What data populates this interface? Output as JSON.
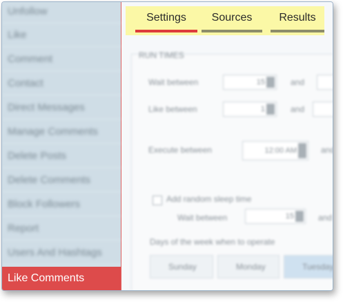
{
  "sidebar": {
    "items": [
      {
        "label": "Unfollow"
      },
      {
        "label": "Like"
      },
      {
        "label": "Comment"
      },
      {
        "label": "Contact"
      },
      {
        "label": "Direct Messages"
      },
      {
        "label": "Manage Comments"
      },
      {
        "label": "Delete Posts"
      },
      {
        "label": "Delete Comments"
      },
      {
        "label": "Block Followers"
      },
      {
        "label": "Report"
      },
      {
        "label": "Users And Hashtags"
      },
      {
        "label": "Like Comments"
      }
    ],
    "active_index": 11
  },
  "tabs": [
    {
      "label": "Settings",
      "active": true
    },
    {
      "label": "Sources",
      "active": false
    },
    {
      "label": "Results",
      "active": false
    }
  ],
  "settings": {
    "section_title": "RUN TIMES",
    "wait_between": {
      "label": "Wait between",
      "from": "15",
      "and_label": "and"
    },
    "like_between": {
      "label": "Like between",
      "from": "1",
      "and_label": "and"
    },
    "execute_between": {
      "label": "Execute between",
      "from": "12:00 AM",
      "and_label": "and"
    },
    "random_sleep": {
      "label": "Add random sleep time",
      "checked": true
    },
    "sleep_wait_between": {
      "label": "Wait between",
      "from": "15",
      "and_label": "and"
    },
    "days_label": "Days of the week when to operate",
    "days": [
      {
        "label": "Sunday",
        "checked": true
      },
      {
        "label": "Monday",
        "checked": true
      },
      {
        "label": "Tuesday",
        "checked": true
      }
    ]
  },
  "colors": {
    "sidebar_bg": "#cfdde6",
    "active_item": "#dd4b4b",
    "tab_highlight": "#fbf8a6",
    "active_tab_bar": "#dd3b3b"
  }
}
